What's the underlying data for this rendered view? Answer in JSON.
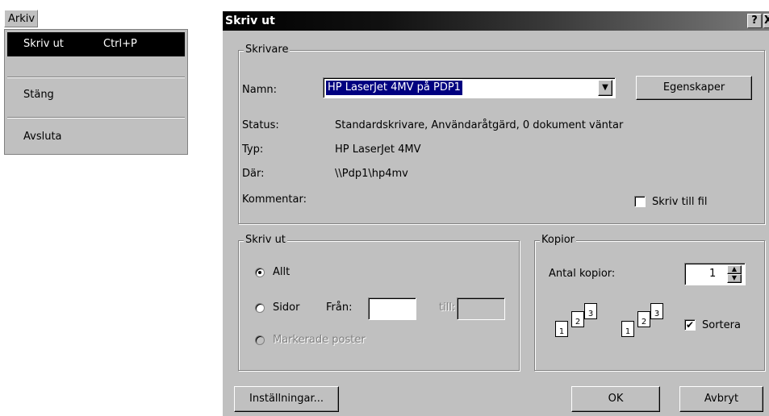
{
  "menu": {
    "bar_item": "Arkiv",
    "items": [
      {
        "label": "Skriv ut",
        "shortcut": "Ctrl+P"
      },
      {
        "label": "Stäng"
      },
      {
        "label": "Avsluta"
      }
    ]
  },
  "dialog": {
    "title": "Skriv ut",
    "help_button": "?",
    "close_button": "X",
    "printer_group": {
      "title": "Skrivare",
      "name_label": "Namn:",
      "name_value": "HP LaserJet 4MV på PDP1",
      "properties_button": "Egenskaper",
      "status_label": "Status:",
      "status_value": "Standardskrivare, Användaråtgärd, 0 dokument väntar",
      "type_label": "Typ:",
      "type_value": "HP LaserJet 4MV",
      "where_label": "Där:",
      "where_value": "\\\\Pdp1\\hp4mv",
      "comment_label": "Kommentar:",
      "print_to_file_label": "Skriv till fil",
      "print_to_file_checked": false
    },
    "range_group": {
      "title": "Skriv ut",
      "all_label": "Allt",
      "pages_label": "Sidor",
      "from_label": "Från:",
      "to_label": "till:",
      "from_value": "",
      "to_value": "",
      "selection_label": "Markerade poster",
      "selected": "all"
    },
    "copies_group": {
      "title": "Kopior",
      "count_label": "Antal kopior:",
      "count_value": "1",
      "collate_label": "Sortera",
      "collate_checked": true,
      "page_numbers": [
        "1",
        "2",
        "3"
      ]
    },
    "settings_button": "Inställningar...",
    "ok_button": "OK",
    "cancel_button": "Avbryt"
  }
}
